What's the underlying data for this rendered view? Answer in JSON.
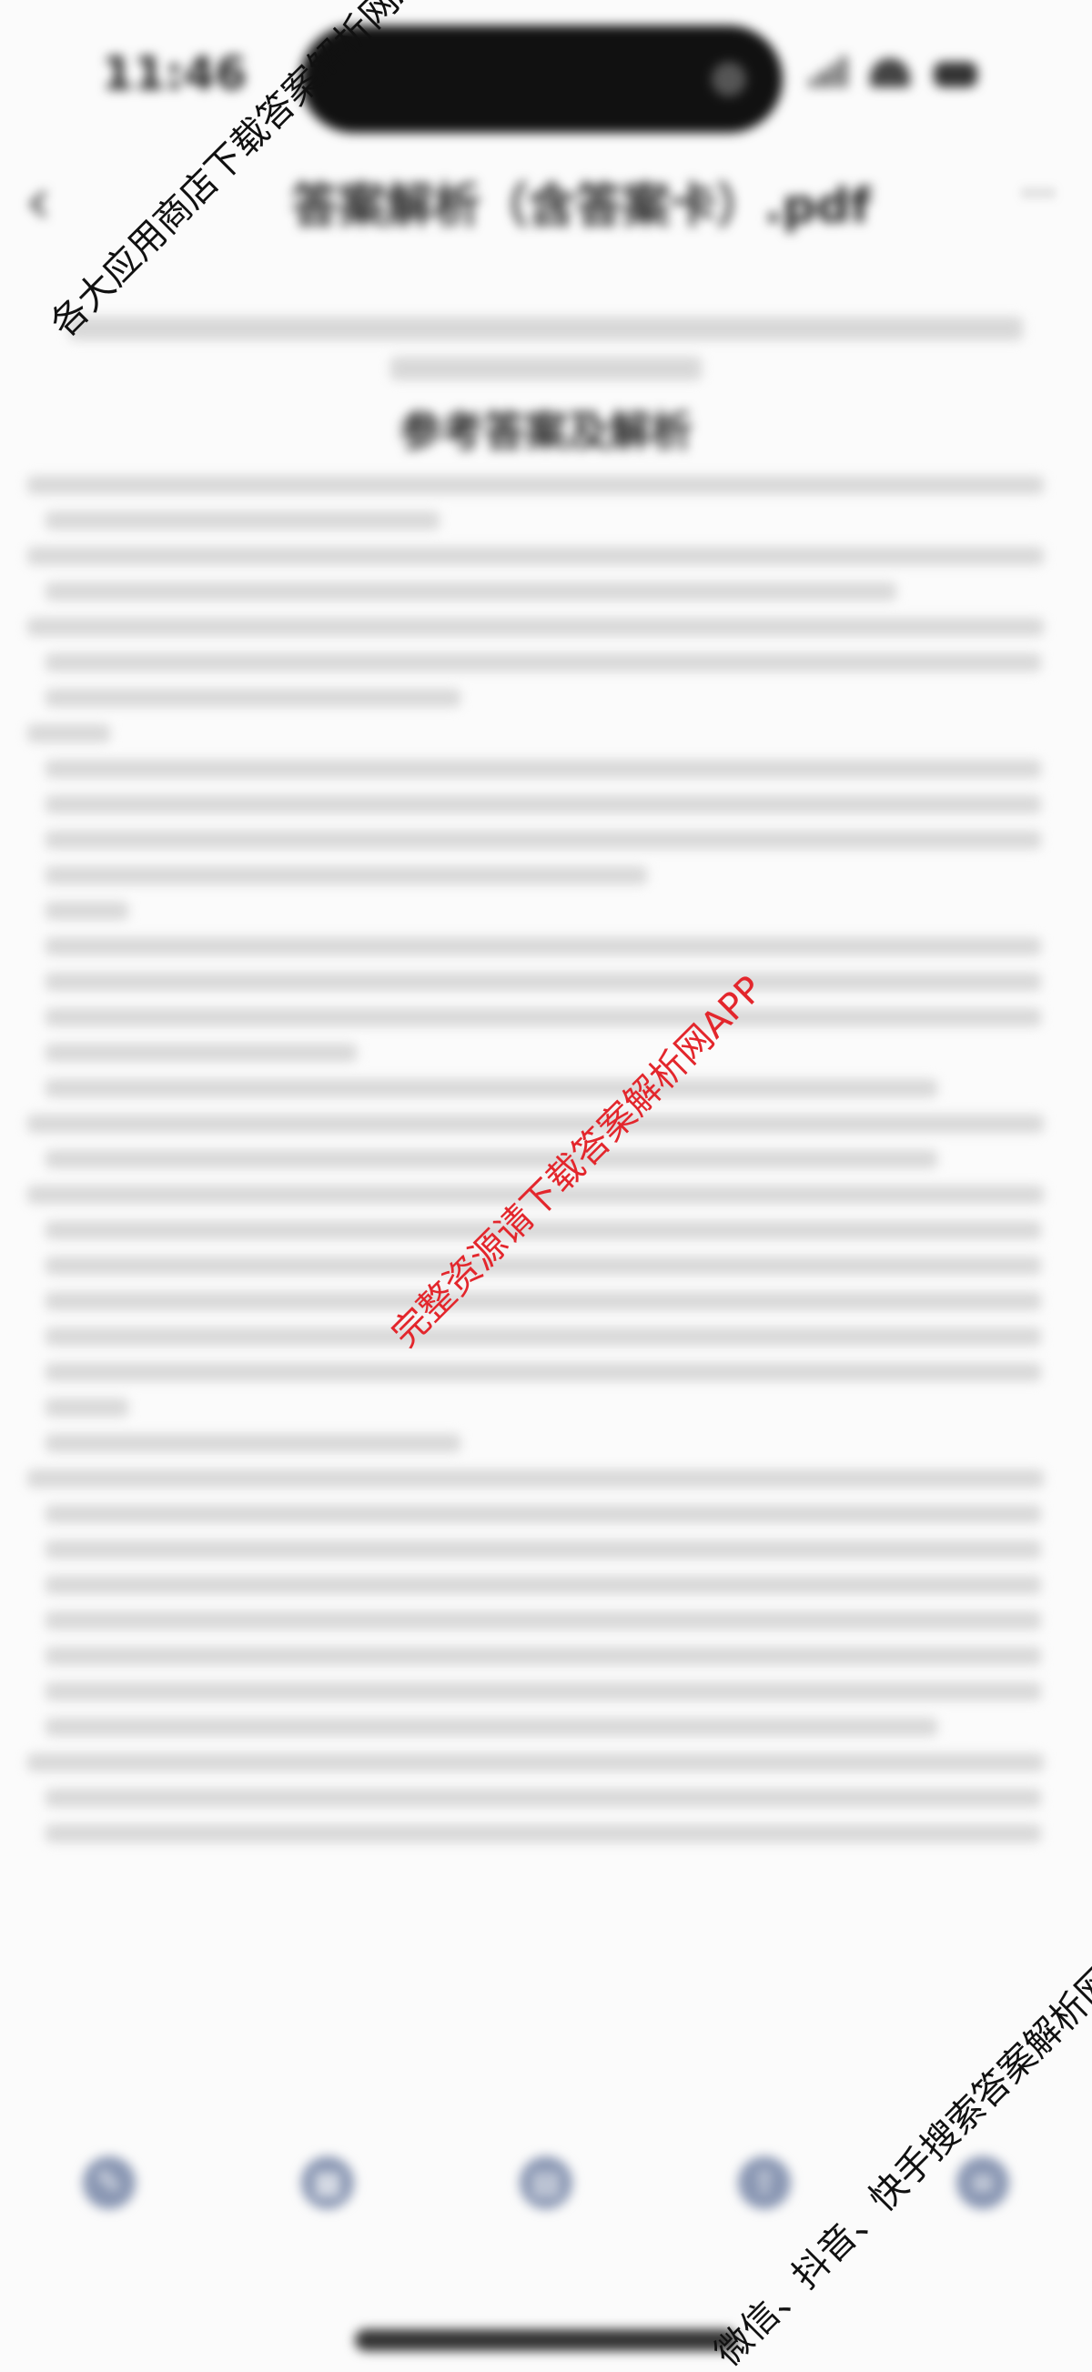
{
  "status_bar": {
    "time": "11:46"
  },
  "nav": {
    "title": "答案解析（含答案卡）.pdf"
  },
  "document": {
    "heading": "",
    "subheading": "参考答案及解析",
    "footer": ""
  },
  "toolbar": {
    "items": [
      {
        "label": "",
        "icon": "pen-icon"
      },
      {
        "label": "",
        "icon": "grid-icon"
      },
      {
        "label": "",
        "icon": "page-icon"
      },
      {
        "label": "",
        "icon": "share-icon"
      },
      {
        "label": "",
        "icon": "menu-icon"
      }
    ]
  },
  "watermarks": {
    "top_left": "各大应用商店下载答案解析网APP",
    "center": "完整资源请下载答案解析网APP",
    "bottom_right": "微信、抖音、快手搜索答案解析网"
  }
}
